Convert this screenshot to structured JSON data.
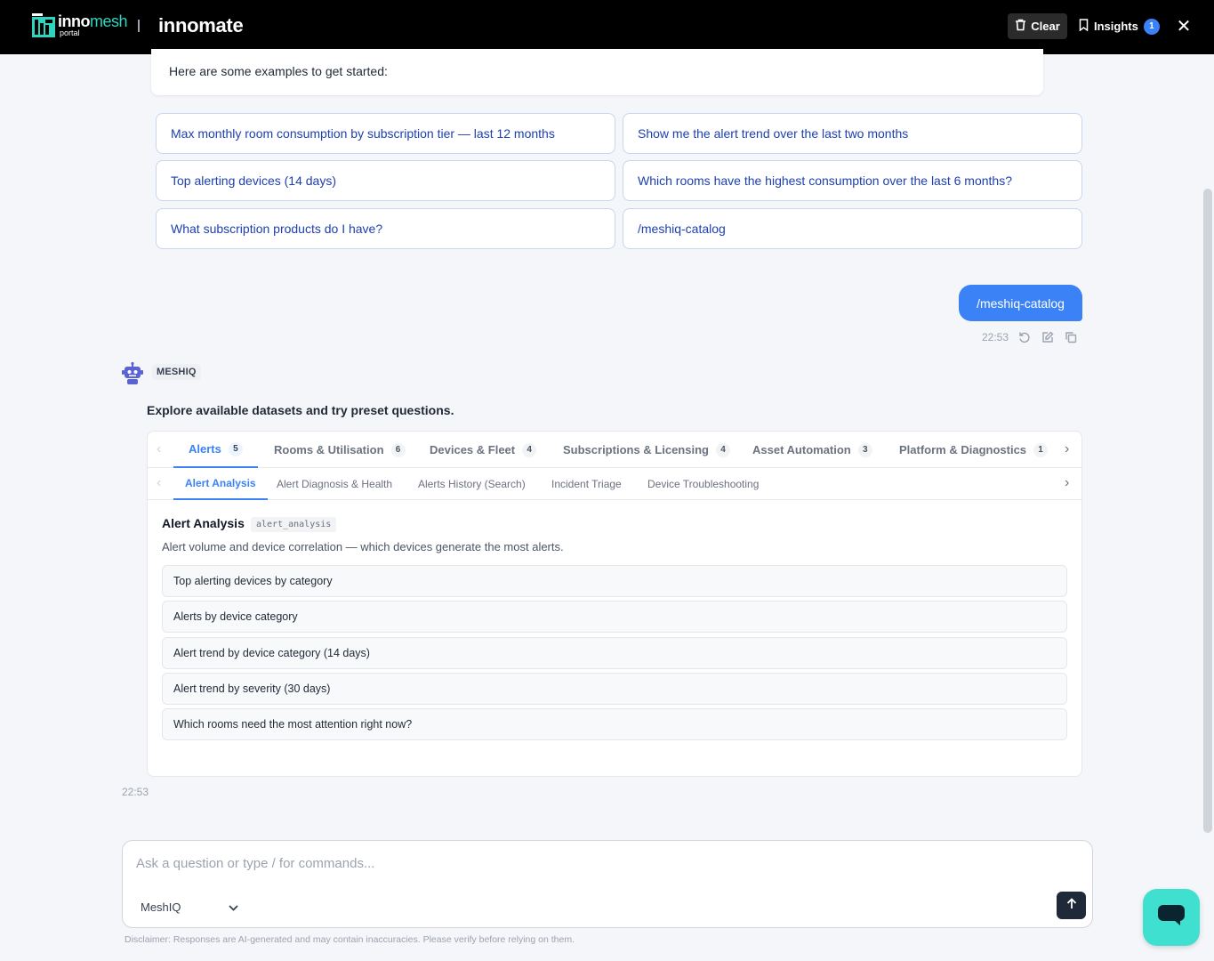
{
  "header": {
    "logo_primary": "inno",
    "logo_accent": "mesh",
    "logo_sub": "portal",
    "separator": "|",
    "brand": "innomate",
    "clear_label": "Clear",
    "insights_label": "Insights",
    "insights_count": "1",
    "close_glyph": "✕"
  },
  "welcome": {
    "text": "Here are some examples to get started:"
  },
  "suggestions": [
    "Max monthly room consumption by subscription tier — last 12 months",
    "Show me the alert trend over the last two months",
    "Top alerting devices (14 days)",
    "Which rooms have the highest consumption over the last 6 months?",
    "What subscription products do I have?",
    "/meshiq-catalog"
  ],
  "user_message": {
    "text": "/meshiq-catalog",
    "time": "22:53",
    "icons": [
      "retry-icon",
      "edit-icon",
      "copy-icon"
    ]
  },
  "assistant": {
    "name": "MESHIQ",
    "intro": "Explore available datasets and try preset questions.",
    "time": "22:53"
  },
  "catalog": {
    "tabs": [
      {
        "label": "Alerts",
        "count": "5",
        "active": true
      },
      {
        "label": "Rooms & Utilisation",
        "count": "6"
      },
      {
        "label": "Devices & Fleet",
        "count": "4"
      },
      {
        "label": "Subscriptions & Licensing",
        "count": "4"
      },
      {
        "label": "Asset Automation",
        "count": "3"
      },
      {
        "label": "Platform & Diagnostics",
        "count": "1"
      }
    ],
    "subtabs": [
      "Alert Analysis",
      "Alert Diagnosis & Health",
      "Alerts History (Search)",
      "Incident Triage",
      "Device Troubleshooting"
    ],
    "dataset": {
      "title": "Alert Analysis",
      "code": "alert_analysis",
      "description": "Alert volume and device correlation — which devices generate the most alerts."
    },
    "questions": [
      "Top alerting devices by category",
      "Alerts by device category",
      "Alert trend by device category (14 days)",
      "Alert trend by severity (30 days)",
      "Which rooms need the most attention right now?"
    ],
    "arrow_left": "‹",
    "arrow_right": "›"
  },
  "composer": {
    "placeholder": "Ask a question or type / for commands...",
    "model": "MeshIQ",
    "disclaimer": "Disclaimer: Responses are AI-generated and may contain inaccuracies. Please verify before relying on them."
  },
  "colors": {
    "accent": "#3b82f6",
    "brand_teal": "#2dd4bf",
    "fab": "#3fe0cf",
    "header_bg": "#000000"
  }
}
